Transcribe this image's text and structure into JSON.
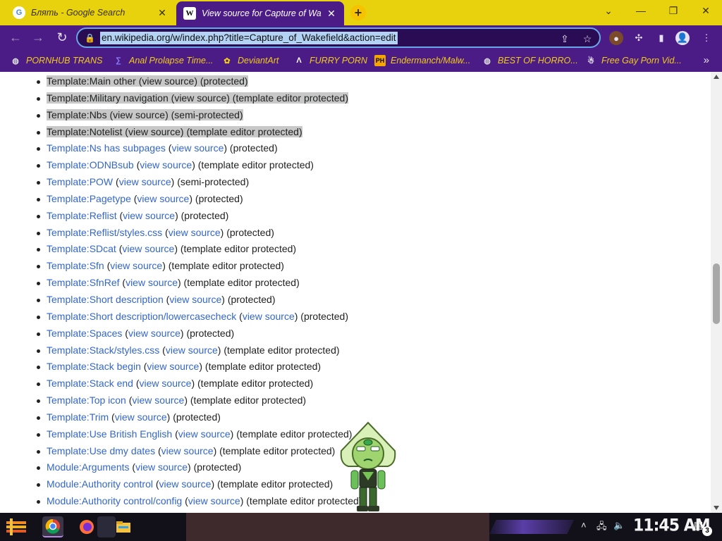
{
  "browser": {
    "tabs": [
      {
        "title": "Блять - Google Search",
        "favicon": "google-icon",
        "active": false
      },
      {
        "title": "View source for Capture of Wa",
        "favicon": "wikipedia-icon",
        "active": true
      }
    ],
    "address_bar": {
      "url": "en.wikipedia.org/w/index.php?title=Capture_of_Wakefield&action=edit"
    },
    "bookmarks": [
      {
        "label": "PORNHUB TRANS",
        "icon": "globe-icon"
      },
      {
        "label": "Anal Prolapse Time...",
        "icon": "bracket-icon"
      },
      {
        "label": "DeviantArt",
        "icon": "deviantart-icon"
      },
      {
        "label": "FURRY PORN",
        "icon": "lambda-icon"
      },
      {
        "label": "Endermanch/Malw...",
        "icon": "ph-icon"
      },
      {
        "label": "BEST OF HORRO...",
        "icon": "globe-icon"
      },
      {
        "label": "Free Gay Porn Vid...",
        "icon": "bot-icon"
      }
    ],
    "colors": {
      "tabstrip": "#e7d20d",
      "toolbar": "#4b1c86",
      "bookmark_text": "#f2cc17",
      "link": "#3366cc"
    }
  },
  "page": {
    "items": [
      {
        "name": "Template:Main other",
        "view": "view source",
        "status": "(protected)",
        "selected": true
      },
      {
        "name": "Template:Military navigation",
        "view": "view source",
        "status": "(template editor protected)",
        "selected": true
      },
      {
        "name": "Template:Nbs",
        "view": "view source",
        "status": "(semi-protected)",
        "selected": true
      },
      {
        "name": "Template:Notelist",
        "view": "view source",
        "status": "(template editor protected)",
        "selected": true
      },
      {
        "name": "Template:Ns has subpages",
        "view": "view source",
        "status": "(protected)",
        "selected": false
      },
      {
        "name": "Template:ODNBsub",
        "view": "view source",
        "status": "(template editor protected)",
        "selected": false
      },
      {
        "name": "Template:POW",
        "view": "view source",
        "status": "(semi-protected)",
        "selected": false
      },
      {
        "name": "Template:Pagetype",
        "view": "view source",
        "status": "(protected)",
        "selected": false
      },
      {
        "name": "Template:Reflist",
        "view": "view source",
        "status": "(protected)",
        "selected": false
      },
      {
        "name": "Template:Reflist/styles.css",
        "view": "view source",
        "status": "(protected)",
        "selected": false
      },
      {
        "name": "Template:SDcat",
        "view": "view source",
        "status": "(template editor protected)",
        "selected": false
      },
      {
        "name": "Template:Sfn",
        "view": "view source",
        "status": "(template editor protected)",
        "selected": false
      },
      {
        "name": "Template:SfnRef",
        "view": "view source",
        "status": "(template editor protected)",
        "selected": false
      },
      {
        "name": "Template:Short description",
        "view": "view source",
        "status": "(protected)",
        "selected": false
      },
      {
        "name": "Template:Short description/lowercasecheck",
        "view": "view source",
        "status": "(protected)",
        "selected": false
      },
      {
        "name": "Template:Spaces",
        "view": "view source",
        "status": "(protected)",
        "selected": false
      },
      {
        "name": "Template:Stack/styles.css",
        "view": "view source",
        "status": "(template editor protected)",
        "selected": false
      },
      {
        "name": "Template:Stack begin",
        "view": "view source",
        "status": "(template editor protected)",
        "selected": false
      },
      {
        "name": "Template:Stack end",
        "view": "view source",
        "status": "(template editor protected)",
        "selected": false
      },
      {
        "name": "Template:Top icon",
        "view": "view source",
        "status": "(template editor protected)",
        "selected": false
      },
      {
        "name": "Template:Trim",
        "view": "view source",
        "status": "(protected)",
        "selected": false
      },
      {
        "name": "Template:Use British English",
        "view": "view source",
        "status": "(template editor protected)",
        "selected": false
      },
      {
        "name": "Template:Use dmy dates",
        "view": "view source",
        "status": "(template editor protected)",
        "selected": false
      },
      {
        "name": "Module:Arguments",
        "view": "view source",
        "status": "(protected)",
        "selected": false
      },
      {
        "name": "Module:Authority control",
        "view": "view source",
        "status": "(template editor protected)",
        "selected": false
      },
      {
        "name": "Module:Authority control/config",
        "view": "view source",
        "status": "(template editor protected)",
        "selected": false
      }
    ]
  },
  "taskbar": {
    "apps": [
      "chrome-icon",
      "firefox-icon",
      "terminal-icon",
      "file-explorer-icon"
    ],
    "clock": "11:45 AM",
    "notification_count": "3"
  }
}
